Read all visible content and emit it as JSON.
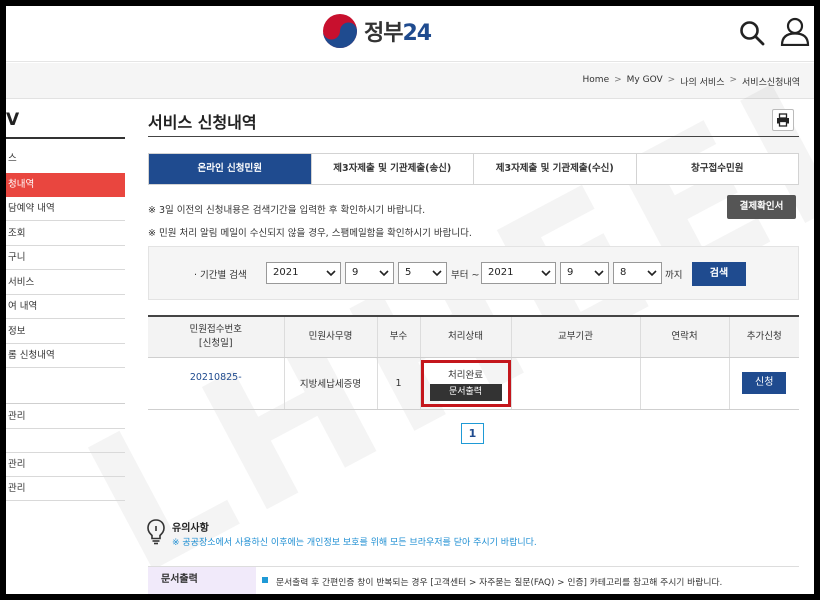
{
  "header": {
    "logo_text": "정부",
    "logo_num": "24"
  },
  "breadcrumb": [
    "Home",
    "My GOV",
    "나의 서비스",
    "서비스신청내역"
  ],
  "breadcrumb_sep": ">",
  "sidebar": {
    "title": "V",
    "items": [
      "스",
      "청내역",
      "담예약 내역",
      "조회",
      "구니",
      "서비스",
      "여 내역",
      "정보",
      "롬 신청내역"
    ],
    "items2": [
      "관리",
      "",
      "관리",
      "관리"
    ]
  },
  "main": {
    "title": "서비스 신청내역",
    "tabs": [
      "온라인 신청민원",
      "제3자제출 및 기관제출(송신)",
      "제3자제출 및 기관제출(수신)",
      "창구접수민원"
    ],
    "notice1": "※ 3일 이전의 신청내용은 검색기간을 입력한 후 확인하시기 바랍니다.",
    "notice2": "※ 민원 처리 알림 메일이 수신되지 않을 경우, 스팸메일함을 확인하시기 바랍니다.",
    "confirm_button": "결제확인서"
  },
  "filter": {
    "label": "· 기간별 검색",
    "from_year": "2021",
    "from_month": "9",
    "from_day": "5",
    "from_text": "부터 ~",
    "to_year": "2021",
    "to_month": "9",
    "to_day": "8",
    "to_text": "까지",
    "search_button": "검색"
  },
  "table": {
    "headers": [
      "민원접수번호\n[신청일]",
      "민원사무명",
      "부수",
      "처리상태",
      "교부기관",
      "연락처",
      "추가신청"
    ],
    "header_line1": "민원접수번호",
    "header_line2": "[신청일]",
    "row": {
      "number": "20210825-",
      "name": "지방세납세증명",
      "copies": "1",
      "status": "처리완료",
      "print_button": "문서출력",
      "agency": "",
      "contact": "",
      "apply_button": "신청"
    }
  },
  "pagination": {
    "current": "1"
  },
  "caution": {
    "title": "유의사항",
    "text": "※ 공공장소에서 사용하신 이후에는 개인정보 보호를 위해 모든 브라우저를 닫아 주시기 바랍니다."
  },
  "doc_output": {
    "label": "문서출력",
    "text": "문서출력 후 간편인증 창이 반복되는 경우 [고객센터 > 자주묻는 질문(FAQ) > 인증] 카테고리를 참고해 주시기 바랍니다."
  },
  "watermark": "LHHEEL",
  "colors": {
    "primary": "#1f4b8f",
    "active_sidebar": "#e9463f",
    "highlight_box": "#c4161c",
    "dark_button": "#555555"
  }
}
